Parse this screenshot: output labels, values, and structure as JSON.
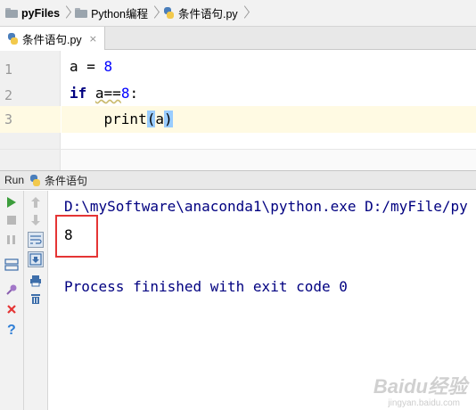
{
  "breadcrumb": {
    "project": "pyFiles",
    "folder": "Python编程",
    "file": "条件语句.py"
  },
  "editor_tab": {
    "label": "条件语句.py",
    "close": "×"
  },
  "editor": {
    "line_numbers": [
      "1",
      "2",
      "3"
    ],
    "lines": {
      "l1_var": "a",
      "l1_op": " = ",
      "l1_num": "8",
      "l2_kw": "if",
      "l2_sp": " ",
      "l2_var": "a",
      "l2_op": "==",
      "l2_num": "8",
      "l2_colon": ":",
      "l3_indent": "    ",
      "l3_func": "print",
      "l3_open": "(",
      "l3_arg": "a",
      "l3_close": ")"
    }
  },
  "run_panel": {
    "title": "Run",
    "config_name": "条件语句"
  },
  "console": {
    "command": "D:\\mySoftware\\anaconda1\\python.exe D:/myFile/py",
    "output": "8",
    "exit_message": "Process finished with exit code 0"
  },
  "watermark": {
    "brand": "Baidu经验",
    "url": "jingyan.baidu.com"
  },
  "colors": {
    "run_green": "#3c9d3c",
    "stop_red": "#e53535",
    "help_blue": "#2f7fd6",
    "console_blue": "#000080",
    "highlight_box": "#e53535"
  },
  "icons": {
    "rerun": "play-icon",
    "stop": "stop-icon",
    "pause": "pause-icon",
    "close": "close-icon",
    "help": "help-icon",
    "print": "print-icon",
    "trash": "trash-icon"
  }
}
